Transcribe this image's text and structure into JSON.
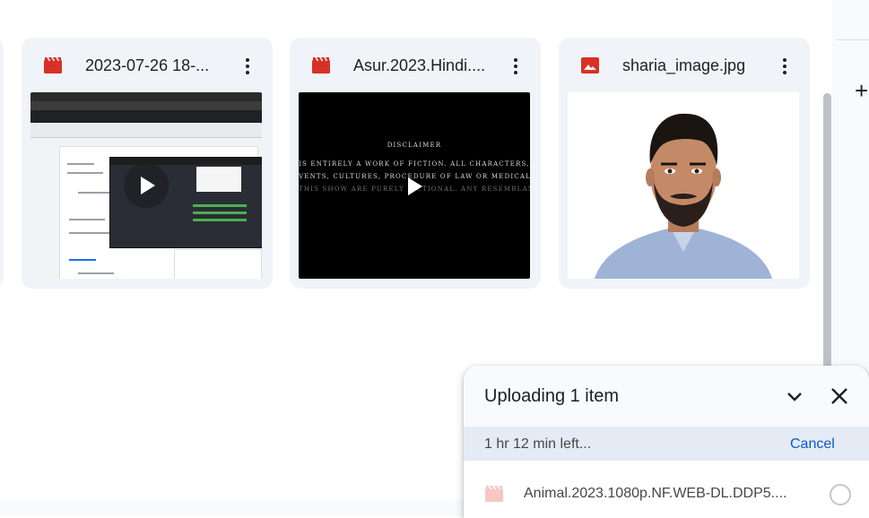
{
  "files": [
    {
      "name": "2023-07-26 18-...",
      "type": "video",
      "icon": "video-file-icon",
      "thumbnail": "screen-recording-thumbnail"
    },
    {
      "name": "Asur.2023.Hindi....",
      "type": "video",
      "icon": "video-file-icon",
      "thumbnail": "disclaimer-video-thumbnail",
      "thumb_text": [
        "DISCLAIMER",
        "IS ENTIRELY A WORK OF FICTION. ALL CHARACTERS, NAMES OF",
        "VENTS, CULTURES, PROCEDURE OF LAW OR MEDICAL OR RELIGI",
        "THIS SHOW ARE PURELY FICTIONAL. ANY RESEMBLANCE TO ANY"
      ]
    },
    {
      "name": "sharia_image.jpg",
      "type": "image",
      "icon": "image-file-icon",
      "thumbnail": "portrait-photo-thumbnail"
    }
  ],
  "side_panel": {
    "add_icon": "plus-icon",
    "add_label": "+"
  },
  "upload_panel": {
    "title": "Uploading 1 item",
    "collapse_icon": "chevron-down-icon",
    "close_icon": "close-icon",
    "time_left": "1 hr 12 min left...",
    "cancel_label": "Cancel",
    "items": [
      {
        "name": "Animal.2023.1080p.NF.WEB-DL.DDP5....",
        "icon": "video-file-icon",
        "status": "pending"
      }
    ]
  },
  "colors": {
    "card_bg": "#f0f4f9",
    "file_icon_red": "#d93025",
    "accent_blue": "#0b57d0",
    "status_bar_bg": "#e5ebf5"
  }
}
